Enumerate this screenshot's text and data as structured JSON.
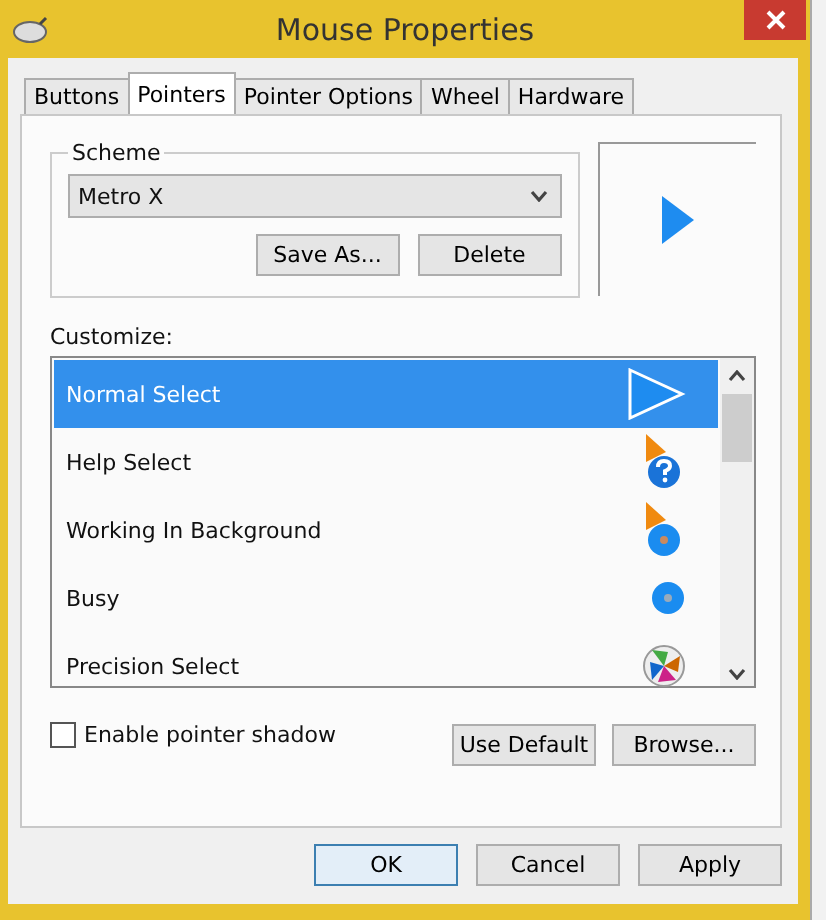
{
  "window": {
    "title": "Mouse Properties"
  },
  "tabs": [
    {
      "label": "Buttons",
      "selected": false
    },
    {
      "label": "Pointers",
      "selected": true
    },
    {
      "label": "Pointer Options",
      "selected": false
    },
    {
      "label": "Wheel",
      "selected": false
    },
    {
      "label": "Hardware",
      "selected": false
    }
  ],
  "scheme": {
    "label": "Scheme",
    "value": "Metro X",
    "buttons": [
      "Save As...",
      "Delete"
    ]
  },
  "customize": {
    "label": "Customize:",
    "items": [
      {
        "name": "Normal Select",
        "kind": "arrow",
        "selected": true
      },
      {
        "name": "Help Select",
        "kind": "help",
        "selected": false
      },
      {
        "name": "Working In Background",
        "kind": "working",
        "selected": false
      },
      {
        "name": "Busy",
        "kind": "busy",
        "selected": false
      },
      {
        "name": "Precision Select",
        "kind": "precision",
        "selected": false
      }
    ]
  },
  "shadow": {
    "label": "Enable pointer shadow",
    "checked": false
  },
  "pointer_buttons": [
    "Use Default",
    "Browse..."
  ],
  "dialog_buttons": [
    {
      "label": "OK",
      "default": true
    },
    {
      "label": "Cancel",
      "default": false
    },
    {
      "label": "Apply",
      "default": false
    }
  ]
}
